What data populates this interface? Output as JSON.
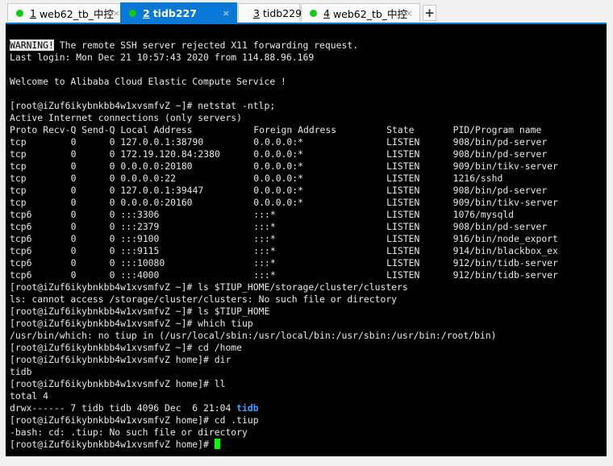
{
  "tabs": [
    {
      "num": "1",
      "label": "web62_tb_中控",
      "active": false
    },
    {
      "num": "2",
      "label": "tidb227",
      "active": true
    },
    {
      "num": "3",
      "label": "tidb229",
      "active": false
    },
    {
      "num": "4",
      "label": "web62_tb_中控",
      "active": false
    }
  ],
  "new_tab_label": "+",
  "close_glyph": "×",
  "terminal": {
    "warning_badge": "WARNING!",
    "warning_text": " The remote SSH server rejected X11 forwarding request.",
    "last_login": "Last login: Mon Dec 21 10:57:43 2020 from 114.88.96.169",
    "welcome": "Welcome to Alibaba Cloud Elastic Compute Service !",
    "cmd_netstat": "[root@iZuf6ikybnkbb4w1xvsmfvZ ~]# netstat -ntlp;",
    "active_conn": "Active Internet connections (only servers)",
    "netstat_header": [
      "Proto",
      "Recv-Q",
      "Send-Q",
      "Local Address",
      "Foreign Address",
      "State",
      "PID/Program name"
    ],
    "netstat_rows": [
      [
        "tcp",
        "0",
        "0",
        "127.0.0.1:38790",
        "0.0.0.0:*",
        "LISTEN",
        "908/bin/pd-server"
      ],
      [
        "tcp",
        "0",
        "0",
        "172.19.120.84:2380",
        "0.0.0.0:*",
        "LISTEN",
        "908/bin/pd-server"
      ],
      [
        "tcp",
        "0",
        "0",
        "0.0.0.0:20180",
        "0.0.0.0:*",
        "LISTEN",
        "909/bin/tikv-server"
      ],
      [
        "tcp",
        "0",
        "0",
        "0.0.0.0:22",
        "0.0.0.0:*",
        "LISTEN",
        "1216/sshd"
      ],
      [
        "tcp",
        "0",
        "0",
        "127.0.0.1:39447",
        "0.0.0.0:*",
        "LISTEN",
        "908/bin/pd-server"
      ],
      [
        "tcp",
        "0",
        "0",
        "0.0.0.0:20160",
        "0.0.0.0:*",
        "LISTEN",
        "909/bin/tikv-server"
      ],
      [
        "tcp6",
        "0",
        "0",
        ":::3306",
        ":::*",
        "LISTEN",
        "1076/mysqld"
      ],
      [
        "tcp6",
        "0",
        "0",
        ":::2379",
        ":::*",
        "LISTEN",
        "908/bin/pd-server"
      ],
      [
        "tcp6",
        "0",
        "0",
        ":::9100",
        ":::*",
        "LISTEN",
        "916/bin/node_export"
      ],
      [
        "tcp6",
        "0",
        "0",
        ":::9115",
        ":::*",
        "LISTEN",
        "914/bin/blackbox_ex"
      ],
      [
        "tcp6",
        "0",
        "0",
        ":::10080",
        ":::*",
        "LISTEN",
        "912/bin/tidb-server"
      ],
      [
        "tcp6",
        "0",
        "0",
        ":::4000",
        ":::*",
        "LISTEN",
        "912/bin/tidb-server"
      ]
    ],
    "after_lines": [
      "[root@iZuf6ikybnkbb4w1xvsmfvZ ~]# ls $TIUP_HOME/storage/cluster/clusters",
      "ls: cannot access /storage/cluster/clusters: No such file or directory",
      "[root@iZuf6ikybnkbb4w1xvsmfvZ ~]# ls $TIUP_HOME",
      "[root@iZuf6ikybnkbb4w1xvsmfvZ ~]# which tiup",
      "/usr/bin/which: no tiup in (/usr/local/sbin:/usr/local/bin:/usr/sbin:/usr/bin:/root/bin)",
      "[root@iZuf6ikybnkbb4w1xvsmfvZ ~]# cd /home",
      "[root@iZuf6ikybnkbb4w1xvsmfvZ home]# dir",
      "tidb",
      "[root@iZuf6ikybnkbb4w1xvsmfvZ home]# ll",
      "total 4"
    ],
    "ll_entry_prefix": "drwx------ 7 tidb tidb 4096 Dec  6 21:04 ",
    "ll_entry_name": "tidb",
    "final_lines": [
      "[root@iZuf6ikybnkbb4w1xvsmfvZ home]# cd .tiup",
      "-bash: cd: .tiup: No such file or directory"
    ],
    "prompt": "[root@iZuf6ikybnkbb4w1xvsmfvZ home]# "
  },
  "colors": {
    "accent": "#0a78d7",
    "status_dot": "#14c814",
    "cursor": "#00ff00",
    "dir": "#3aa0ff"
  }
}
